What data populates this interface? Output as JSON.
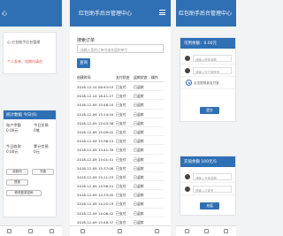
{
  "left": {
    "topbar_title": "心",
    "card1": {
      "line1": "心 红包助手后台管理",
      "line2": "个人发单，短期内请勿"
    },
    "card2": {
      "head": "统计数据 今日(6)",
      "stat1_label": "账户余额",
      "stat1_value": "0.00元",
      "stat2_label": "今日交易",
      "stat2_value": "0笔",
      "stat3_label": "今日收款",
      "stat3_value": "0.00元",
      "stat4_label": "累计交易",
      "stat4_value": "0元",
      "btn1": "收款码",
      "btn2": "充值",
      "btn3": "提现",
      "btn4": "修改登录密码"
    }
  },
  "middle": {
    "topbar_title": "红包助手后台管理中心",
    "section_title": "搜索订单",
    "search_placeholder": "请输入您的订单号或充值的单号",
    "search_button": "查询",
    "table": {
      "headers": [
        "创建时间",
        "支付状态",
        "返款状态",
        "操作"
      ],
      "rows": [
        [
          "2018-12-10 08:43:53",
          "已支付",
          "已返款",
          ""
        ],
        [
          "2018-12-10 18:41:27",
          "已支付",
          "已返款",
          ""
        ],
        [
          "2018-12-09 15:48:10",
          "已支付",
          "已返款",
          ""
        ],
        [
          "2018-12-09 15:14:44",
          "已支付",
          "已返款",
          ""
        ],
        [
          "2018-12-09 15:03:58",
          "已支付",
          "已返款",
          ""
        ],
        [
          "2018-12-09 15:09:02",
          "已支付",
          "已返款",
          ""
        ],
        [
          "2018-12-09 15:36:15",
          "已支付",
          "已返款",
          ""
        ],
        [
          "2018-12-09 15:41:39",
          "已支付",
          "已返款",
          ""
        ],
        [
          "2018-12-09 15:01:41",
          "已支付",
          "已返款",
          ""
        ],
        [
          "2018-12-09 15:37:08",
          "已支付",
          "已返款",
          ""
        ],
        [
          "2018-12-09 15:11:23",
          "已支付",
          "已返款",
          ""
        ],
        [
          "2018-12-09 14:56:41",
          "已支付",
          "已返款",
          ""
        ],
        [
          "2018-12-09 14:33:05",
          "已支付",
          "已返款",
          ""
        ],
        [
          "2018-12-09 14:25:19",
          "已支付",
          "已返款",
          ""
        ],
        [
          "2018-12-09 14:06:42",
          "已支付",
          "已返款",
          ""
        ],
        [
          "2018-12-09 13:48:37",
          "已支付",
          "已返款",
          ""
        ]
      ]
    }
  },
  "right": {
    "topbar_title": "红包助手后台管理中心",
    "card1": {
      "head": "可用余额：0.00元",
      "input1": "请输入提现金额",
      "input2": "请输入支付宝账号",
      "radio_text": "点击提现到支付宝",
      "button": "提交"
    },
    "card2": {
      "head": "充值余额 100元/5",
      "input1": "请输入充值金额",
      "input2": "请输入订单号",
      "button": "充值"
    }
  },
  "colors": {
    "primary": "#2f6fb4",
    "danger": "#d9534f"
  }
}
